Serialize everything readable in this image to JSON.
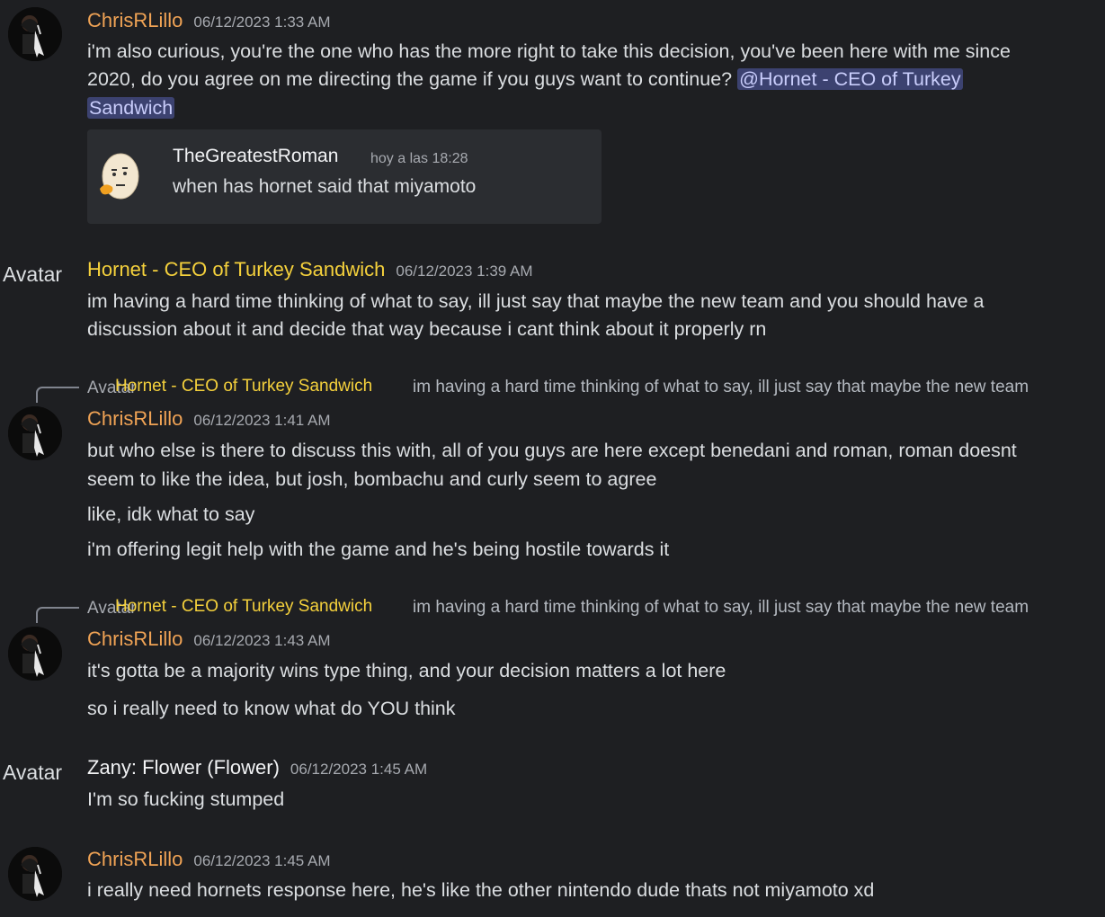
{
  "messages": [
    {
      "author": "ChrisRLillo",
      "time": "06/12/2023 1:33 AM",
      "line1": "i'm also curious, you're the one who has the more right to take this decision, you've been here with me since",
      "line2": "2020, do you agree on me directing the game if you guys want to continue?",
      "mention1": "@Hornet - CEO of Turkey",
      "mention2": "Sandwich",
      "embed": {
        "author": "TheGreatestRoman",
        "time": "hoy a las 18:28",
        "text": "when has hornet said that miyamoto"
      }
    },
    {
      "avatar_alt": "Avatar",
      "author": "Hornet - CEO of Turkey Sandwich",
      "time": "06/12/2023 1:39 AM",
      "line1": "im having a hard time thinking of what to say, ill just say that maybe the new team and you should have a",
      "line2": "discussion about it and decide that way because i cant think about it properly rn"
    },
    {
      "reply": {
        "avatar_alt": "Avatar",
        "author": "Hornet - CEO of Turkey Sandwich",
        "text": "im having a hard time thinking of what to say, ill just say that maybe the new team"
      },
      "author": "ChrisRLillo",
      "time": "06/12/2023 1:41 AM",
      "line1": "but who else is there to discuss this with, all of you guys are here except benedani and roman, roman doesnt",
      "line2": "seem to like the idea, but josh, bombachu and curly seem to agree",
      "line3": "like, idk what to say",
      "line4": "i'm offering legit help with the game and he's being hostile towards it"
    },
    {
      "reply": {
        "avatar_alt": "Avatar",
        "author": "Hornet - CEO of Turkey Sandwich",
        "text": "im having a hard time thinking of what to say, ill just say that maybe the new team"
      },
      "author": "ChrisRLillo",
      "time": "06/12/2023 1:43 AM",
      "line1": "it's gotta be a majority wins type thing, and your decision matters a lot here",
      "line2": "so i really need to know what do YOU think"
    },
    {
      "avatar_alt": "Avatar",
      "author": "Zany: Flower (Flower)",
      "time": "06/12/2023 1:45 AM",
      "line1": "I'm so fucking stumped"
    },
    {
      "author": "ChrisRLillo",
      "time": "06/12/2023 1:45 AM",
      "line1": "i really need hornets response here, he's like the other nintendo dude thats not miyamoto xd"
    }
  ],
  "colors": {
    "background": "#1e1f22",
    "chris_name": "#f0a355",
    "hornet_name": "#f5d13c",
    "mention_bg": "#3c4270",
    "embed_bg": "#2b2d31"
  }
}
